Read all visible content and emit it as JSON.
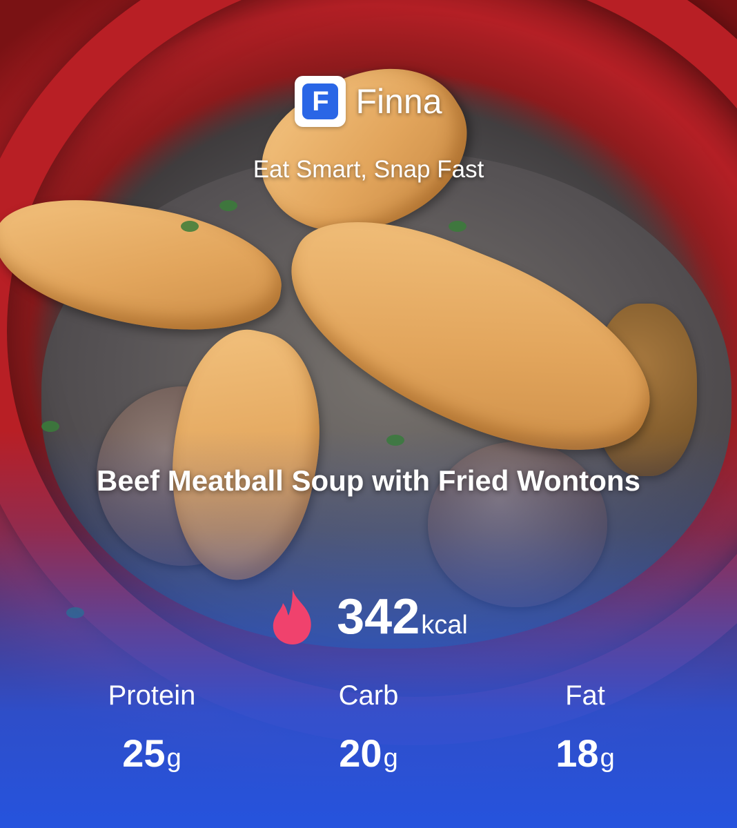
{
  "brand": {
    "logo_letter": "F",
    "name": "Finna",
    "tagline": "Eat Smart, Snap Fast"
  },
  "food": {
    "name": "Beef Meatball Soup with Fried Wontons"
  },
  "calories": {
    "value": "342",
    "unit": "kcal",
    "icon": "flame-icon"
  },
  "macros": [
    {
      "label": "Protein",
      "value": "25",
      "unit": "g"
    },
    {
      "label": "Carb",
      "value": "20",
      "unit": "g"
    },
    {
      "label": "Fat",
      "value": "18",
      "unit": "g"
    }
  ],
  "colors": {
    "accent_blue": "#2a66e6",
    "flame_pink": "#f0426d",
    "bowl_red": "#b81f25"
  }
}
